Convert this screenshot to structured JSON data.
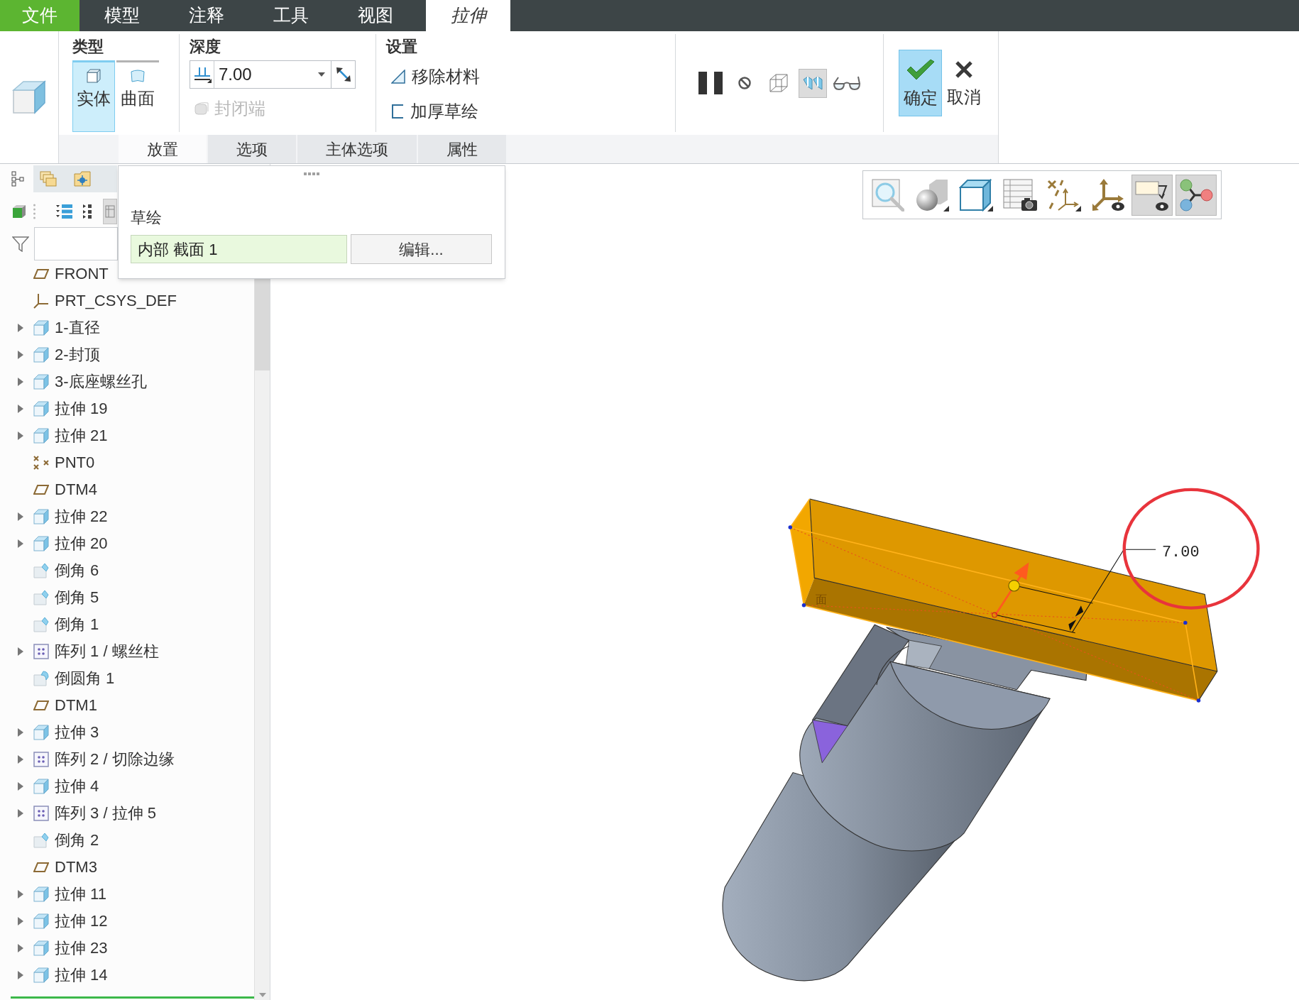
{
  "menu_tabs": [
    {
      "label": "文件",
      "kind": "file",
      "selected": false
    },
    {
      "label": "模型",
      "kind": "tab",
      "selected": false
    },
    {
      "label": "注释",
      "kind": "tab",
      "selected": false
    },
    {
      "label": "工具",
      "kind": "tab",
      "selected": false
    },
    {
      "label": "视图",
      "kind": "tab",
      "selected": false
    },
    {
      "label": "拉伸",
      "kind": "tab",
      "selected": true
    }
  ],
  "ribbon": {
    "type_group": {
      "title": "类型",
      "options": [
        {
          "label": "实体",
          "kind": "solid",
          "selected": true
        },
        {
          "label": "曲面",
          "kind": "surface",
          "selected": false
        }
      ]
    },
    "depth_group": {
      "title": "深度",
      "value": "7.00",
      "capped_ends": {
        "label": "封闭端",
        "disabled": true
      }
    },
    "settings_group": {
      "title": "设置",
      "options": [
        {
          "label": "移除材料",
          "kind": "remove"
        },
        {
          "label": "加厚草绘",
          "kind": "thicken"
        }
      ]
    },
    "tools": [
      {
        "kind": "pause",
        "pressed": false
      },
      {
        "kind": "stop",
        "pressed": false
      },
      {
        "kind": "preview",
        "pressed": false
      },
      {
        "kind": "verify",
        "pressed": true
      },
      {
        "kind": "glasses",
        "pressed": false
      }
    ],
    "confirm": {
      "label": "确定",
      "highlighted": true
    },
    "cancel": {
      "label": "取消"
    },
    "panel_tabs": [
      {
        "label": "放置",
        "selected": true
      },
      {
        "label": "选项",
        "selected": false
      },
      {
        "label": "主体选项",
        "selected": false
      },
      {
        "label": "属性",
        "selected": false
      }
    ]
  },
  "placement_panel": {
    "title": "草绘",
    "sketch": "内部 截面 1",
    "edit_button": "编辑..."
  },
  "model_tree": [
    {
      "label": "FRONT",
      "kind": "plane",
      "expandable": false
    },
    {
      "label": "PRT_CSYS_DEF",
      "kind": "csys",
      "expandable": false
    },
    {
      "label": "1-直径",
      "kind": "extrude",
      "expandable": true
    },
    {
      "label": "2-封顶",
      "kind": "extrude",
      "expandable": true
    },
    {
      "label": "3-底座螺丝孔",
      "kind": "extrude",
      "expandable": true
    },
    {
      "label": "拉伸 19",
      "kind": "extrude",
      "expandable": true
    },
    {
      "label": "拉伸 21",
      "kind": "extrude",
      "expandable": true
    },
    {
      "label": "PNT0",
      "kind": "point",
      "expandable": false
    },
    {
      "label": "DTM4",
      "kind": "plane",
      "expandable": false
    },
    {
      "label": "拉伸 22",
      "kind": "extrude",
      "expandable": true
    },
    {
      "label": "拉伸 20",
      "kind": "extrude",
      "expandable": true
    },
    {
      "label": "倒角 6",
      "kind": "chamfer",
      "expandable": false
    },
    {
      "label": "倒角 5",
      "kind": "chamfer",
      "expandable": false
    },
    {
      "label": "倒角 1",
      "kind": "chamfer",
      "expandable": false
    },
    {
      "label": "阵列 1 / 螺丝柱",
      "kind": "pattern",
      "expandable": true
    },
    {
      "label": "倒圆角 1",
      "kind": "round",
      "expandable": false
    },
    {
      "label": "DTM1",
      "kind": "plane",
      "expandable": false
    },
    {
      "label": "拉伸 3",
      "kind": "extrude",
      "expandable": true
    },
    {
      "label": "阵列 2 / 切除边缘",
      "kind": "pattern",
      "expandable": true
    },
    {
      "label": "拉伸 4",
      "kind": "extrude",
      "expandable": true
    },
    {
      "label": "阵列 3 / 拉伸 5",
      "kind": "pattern",
      "expandable": true
    },
    {
      "label": "倒角 2",
      "kind": "chamfer",
      "expandable": false
    },
    {
      "label": "DTM3",
      "kind": "plane",
      "expandable": false
    },
    {
      "label": "拉伸 11",
      "kind": "extrude",
      "expandable": true
    },
    {
      "label": "拉伸 12",
      "kind": "extrude",
      "expandable": true
    },
    {
      "label": "拉伸 23",
      "kind": "extrude",
      "expandable": true
    },
    {
      "label": "拉伸 14",
      "kind": "extrude",
      "expandable": true
    }
  ],
  "view_toolbar": [
    {
      "kind": "zoom",
      "pressed": false
    },
    {
      "kind": "display",
      "pressed": false
    },
    {
      "kind": "orientation",
      "pressed": false
    },
    {
      "kind": "views",
      "pressed": false
    },
    {
      "kind": "datums",
      "pressed": false
    },
    {
      "kind": "csys",
      "pressed": false
    },
    {
      "kind": "notes",
      "pressed": true
    },
    {
      "kind": "tree",
      "pressed": true
    }
  ],
  "viewport": {
    "dimension": "7.00",
    "section_label": "面"
  }
}
